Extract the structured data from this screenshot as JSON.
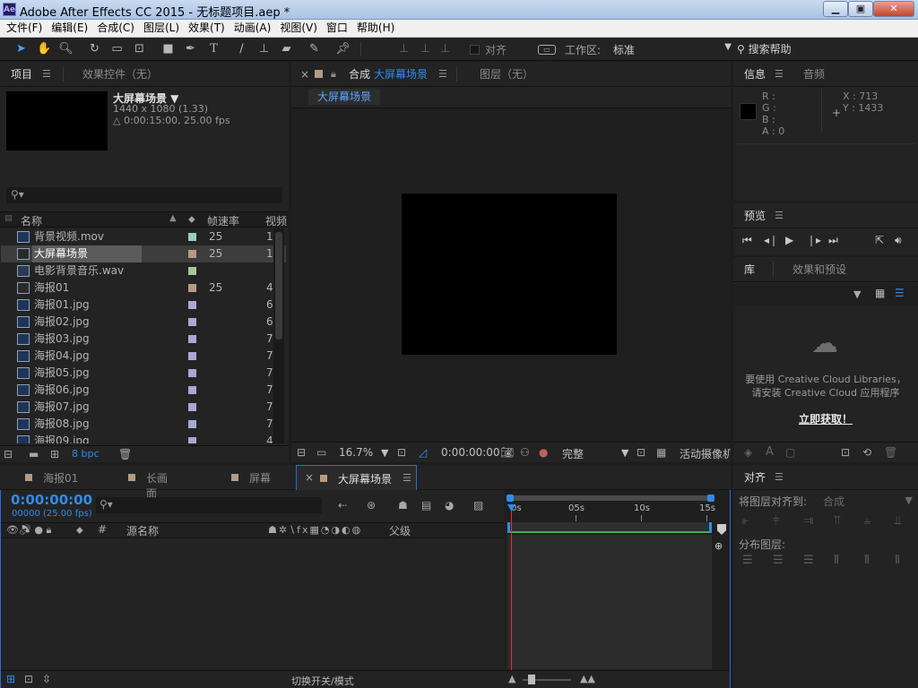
{
  "window": {
    "title": "Adobe After Effects CC 2015 - 无标题项目.aep *",
    "app_icon": "Ae",
    "min": "▁",
    "max": "▣",
    "close": "✕"
  },
  "menu": [
    "文件(F)",
    "编辑(E)",
    "合成(C)",
    "图层(L)",
    "效果(T)",
    "动画(A)",
    "视图(V)",
    "窗口",
    "帮助(H)"
  ],
  "toolbar": {
    "align_label": "对齐",
    "workspace_label": "工作区:",
    "workspace_value": "标准",
    "search_help": "搜索帮助"
  },
  "project": {
    "tab_project": "项目",
    "tab_effects": "效果控件（无）",
    "comp_name": "大屏幕场景 ▼",
    "comp_size": "1440 x 1080 (1.33)",
    "comp_duration": "△ 0:00:15:00, 25.00 fps",
    "search_placeholder": "",
    "columns": {
      "name": "名称",
      "fps": "帧速率",
      "video": "视频"
    },
    "items": [
      {
        "name": "背景视频.mov",
        "fps": "25",
        "video": "1",
        "color": "#9fc9c4",
        "type": "video"
      },
      {
        "name": "大屏幕场景",
        "fps": "25",
        "video": "1",
        "color": "#b69a84",
        "type": "comp"
      },
      {
        "name": "电影背景音乐.wav",
        "fps": "",
        "video": "",
        "color": "#a6c79a",
        "type": "audio"
      },
      {
        "name": "海报01",
        "fps": "25",
        "video": "4",
        "color": "#b69a84",
        "type": "comp"
      },
      {
        "name": "海报01.jpg",
        "fps": "",
        "video": "6",
        "color": "#a8a8d4",
        "type": "image"
      },
      {
        "name": "海报02.jpg",
        "fps": "",
        "video": "6",
        "color": "#a8a8d4",
        "type": "image"
      },
      {
        "name": "海报03.jpg",
        "fps": "",
        "video": "7",
        "color": "#a8a8d4",
        "type": "image"
      },
      {
        "name": "海报04.jpg",
        "fps": "",
        "video": "7",
        "color": "#a8a8d4",
        "type": "image"
      },
      {
        "name": "海报05.jpg",
        "fps": "",
        "video": "7",
        "color": "#a8a8d4",
        "type": "image"
      },
      {
        "name": "海报06.jpg",
        "fps": "",
        "video": "7",
        "color": "#a8a8d4",
        "type": "image"
      },
      {
        "name": "海报07.jpg",
        "fps": "",
        "video": "7",
        "color": "#a8a8d4",
        "type": "image"
      },
      {
        "name": "海报08.jpg",
        "fps": "",
        "video": "7",
        "color": "#a8a8d4",
        "type": "image"
      },
      {
        "name": "海报09.jpg",
        "fps": "",
        "video": "4",
        "color": "#a8a8d4",
        "type": "image"
      }
    ],
    "bpc": "8 bpc"
  },
  "composition": {
    "tab_close": "×",
    "tab_lock": "🔒",
    "tab_prefix": "合成",
    "tab_name": "大屏幕场景",
    "tab_layer": "图层（无）",
    "breadcrumb": "大屏幕场景",
    "zoom": "16.7%",
    "timecode": "0:00:00:00",
    "quality": "完整",
    "camera": "活动摄像机"
  },
  "info": {
    "tab_info": "信息",
    "tab_audio": "音频",
    "r": "R :",
    "g": "G :",
    "b": "B :",
    "a": "A : 0",
    "x": "X : 713",
    "y": "Y : 1433"
  },
  "preview": {
    "tab": "预览"
  },
  "library": {
    "tab_lib": "库",
    "tab_effects": "效果和预设",
    "msg1": "要使用 Creative Cloud Libraries，",
    "msg2": "请安装 Creative Cloud 应用程序",
    "link": "立即获取！"
  },
  "timeline": {
    "tabs": [
      "海报01",
      "长画面",
      "屏幕",
      "大屏幕场景"
    ],
    "tab_colors": [
      "#b69a84",
      "#b69a84",
      "#b69a84",
      "#b69a84"
    ],
    "timecode": "0:00:00:00",
    "frames": "00000 (25.00 fps)",
    "col_source": "源名称",
    "col_parent": "父级",
    "col_num": "#",
    "ruler": [
      "0s",
      "05s",
      "10s",
      "15s"
    ],
    "toggle": "切换开关/模式"
  },
  "align": {
    "tab": "对齐",
    "align_to_label": "将图层对齐到:",
    "align_to_value": "合成",
    "distribute_label": "分布图层:"
  }
}
